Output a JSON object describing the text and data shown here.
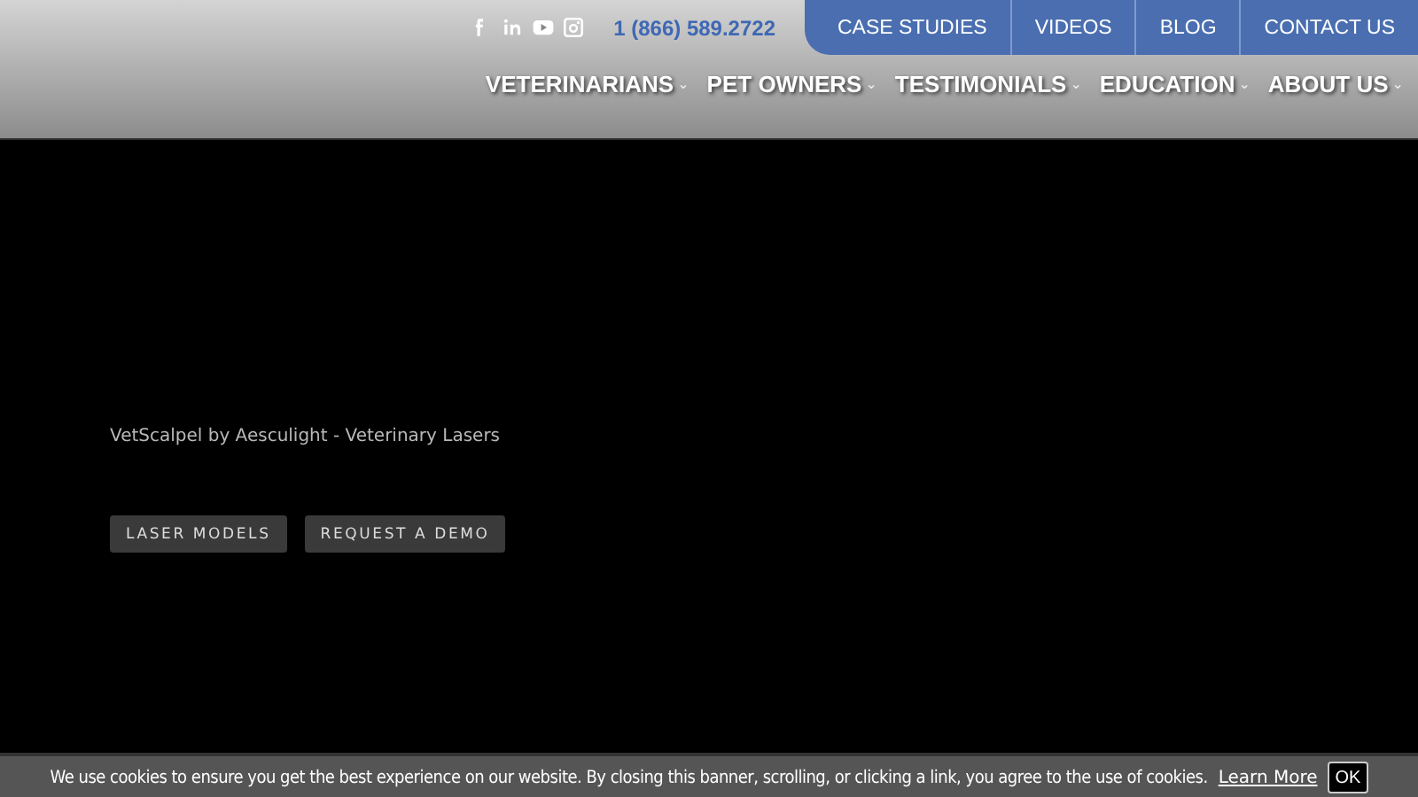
{
  "header": {
    "phone": "1 (866) 589.2722",
    "top_nav": [
      "CASE STUDIES",
      "VIDEOS",
      "BLOG",
      "CONTACT US"
    ],
    "main_nav": [
      {
        "label": "VETERINARIANS",
        "caret": "⌄"
      },
      {
        "label": "PET OWNERS",
        "caret": "⌄"
      },
      {
        "label": "TESTIMONIALS",
        "caret": "⌄"
      },
      {
        "label": "EDUCATION",
        "caret": "⌄"
      },
      {
        "label": "ABOUT US",
        "caret": "⌄"
      }
    ]
  },
  "hero": {
    "tagline": "VetScalpel by Aesculight - Veterinary Lasers",
    "buttons": [
      "LASER MODELS",
      "REQUEST A DEMO"
    ]
  },
  "cookie_banner": {
    "text": "We use cookies to ensure you get the best experience on our website. By closing this banner, scrolling, or clicking a link, you agree to the use of cookies.",
    "link": "Learn More",
    "button": "OK"
  }
}
